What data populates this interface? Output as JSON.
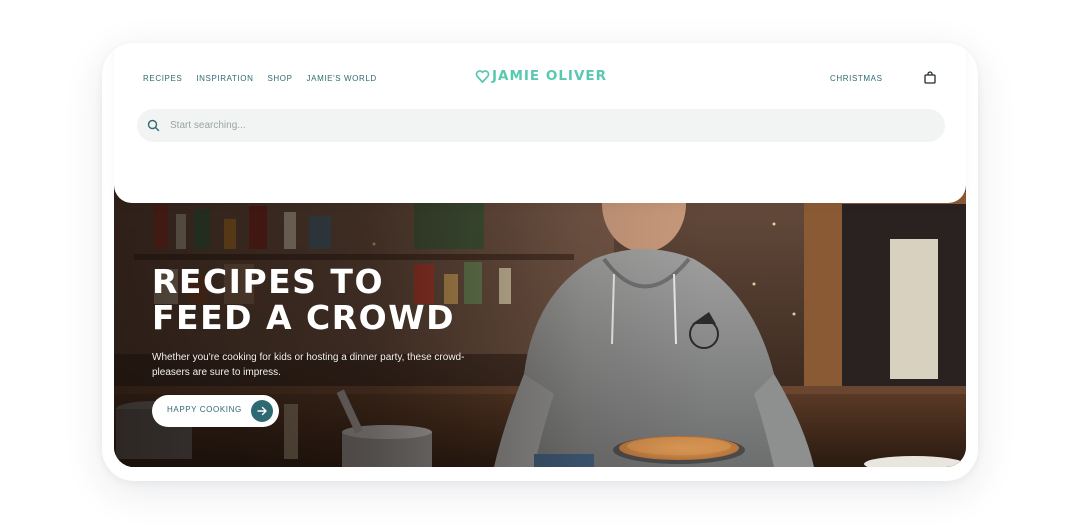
{
  "nav": {
    "links": [
      "RECIPES",
      "INSPIRATION",
      "SHOP",
      "JAMIE'S WORLD"
    ],
    "right_link": "CHRISTMAS"
  },
  "logo": {
    "text": "JAMIE OLIVER",
    "icon": "heart-icon",
    "color": "#58c9b0"
  },
  "search": {
    "placeholder": "Start searching..."
  },
  "hero": {
    "title_line1": "RECIPES TO",
    "title_line2": "FEED A CROWD",
    "subtitle": "Whether you're cooking for kids or hosting a dinner party, these crowd-pleasers are sure to impress.",
    "button_label": "HAPPY COOKING",
    "button_icon": "arrow-right-icon"
  },
  "icons": {
    "search": "search-icon",
    "cart": "shopping-bag-icon"
  },
  "colors": {
    "accent": "#2f6a72",
    "brand": "#58c9b0"
  }
}
